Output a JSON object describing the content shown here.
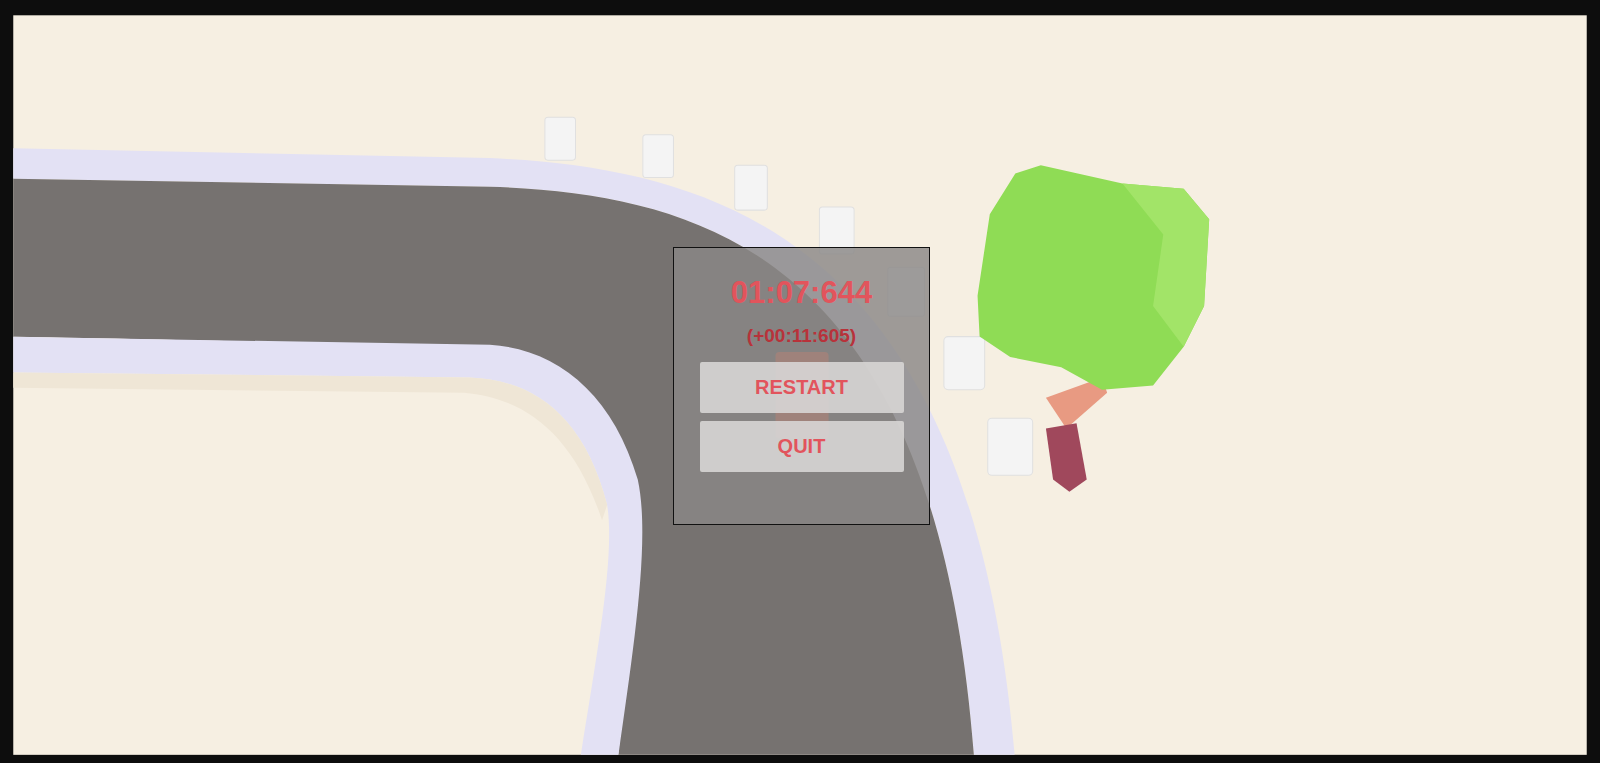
{
  "timer": "01:07:644",
  "delta": "(+00:11:605)",
  "buttons": [
    {
      "label": "RESTART"
    },
    {
      "label": "QUIT"
    }
  ]
}
